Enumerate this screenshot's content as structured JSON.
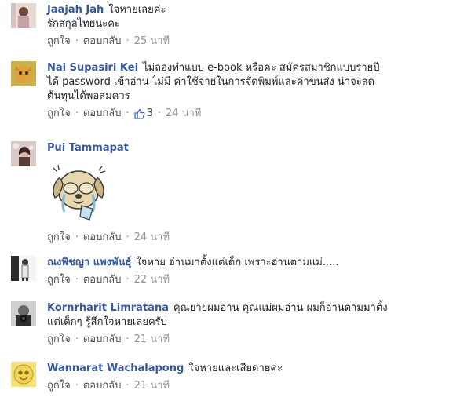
{
  "comments": [
    {
      "author": "Jaajah Jah",
      "text": "ใจหายเลยค่ะ",
      "text2": "รักสกุลไทยนะคะ",
      "like_label": "ถูกใจ",
      "reply_label": "ตอบกลับ",
      "time": "25 นาที"
    },
    {
      "author": "Nai Supasiri Kei",
      "text": "ไม่ลองทำแบบ e-book หรือคะ สมัครสมาชิกแบบรายปี",
      "text2": "ได้ password เข้าอ่าน ไม่มี ค่าใช้จ่ายในการจัดพิมพ์และค่าขนส่ง น่าจะลด",
      "text3": "ต้นทุนได้พอสมควร",
      "like_label": "ถูกใจ",
      "reply_label": "ตอบกลับ",
      "like_count": "3",
      "time": "24 นาที"
    },
    {
      "author": "Pui Tammapat",
      "like_label": "ถูกใจ",
      "reply_label": "ตอบกลับ",
      "time": "24 นาที"
    },
    {
      "author": "ณงพิชญา แพงพันธุ์",
      "text": "ใจหาย อ่านมาตั้งแต่เด็ก เพราะอ่านตามแม่.....",
      "like_label": "ถูกใจ",
      "reply_label": "ตอบกลับ",
      "time": "22 นาที"
    },
    {
      "author": "Kornrharit Limratana",
      "text": "คุณยายผมอ่าน คุณแม่ผมอ่าน ผมก็อ่านตามมาตั้ง",
      "text2": "แต่เด็กๆ รู้สึกใจหายเลยครับ",
      "like_label": "ถูกใจ",
      "reply_label": "ตอบกลับ",
      "time": "21 นาที"
    },
    {
      "author": "Wannarat Wachalapong",
      "text": "ใจหายและเสียดายค่ะ",
      "like_label": "ถูกใจ",
      "reply_label": "ตอบกลับ",
      "time": "21 นาที"
    }
  ],
  "colors": {
    "author": "#365899",
    "meta": "#90949c",
    "action": "#4b4f56",
    "like_icon": "#4267b2"
  },
  "icons": {
    "like": "thumbs-up-icon",
    "sticker": "crying-dog-sticker"
  }
}
